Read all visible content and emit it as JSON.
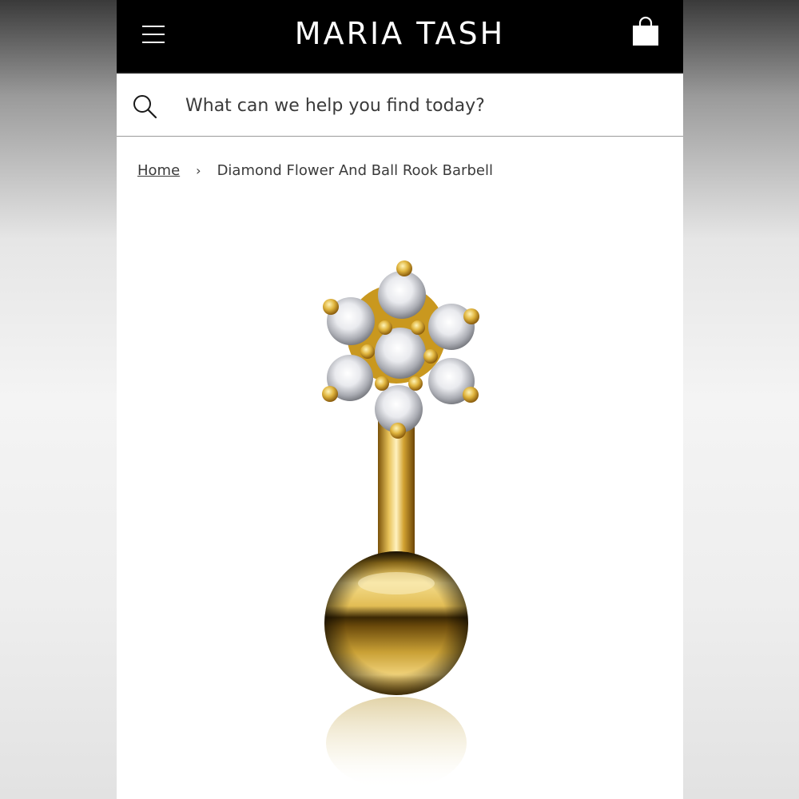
{
  "header": {
    "brand": "MARIA TASH",
    "menu_icon": "hamburger-menu-icon",
    "bag_icon": "shopping-bag-icon"
  },
  "search": {
    "placeholder": "What can we help you find today?",
    "icon": "search-icon"
  },
  "breadcrumb": {
    "home": "Home",
    "separator": "›",
    "current": "Diamond Flower And Ball Rook Barbell"
  },
  "product": {
    "image_alt": "Diamond Flower And Ball Rook Barbell",
    "colors": {
      "gold_light": "#f6e08a",
      "gold": "#d4a62a",
      "gold_dark": "#6e4a06"
    }
  },
  "colors": {
    "header_bg": "#000000",
    "header_text": "#ffffff",
    "text": "#3a3a3a"
  }
}
